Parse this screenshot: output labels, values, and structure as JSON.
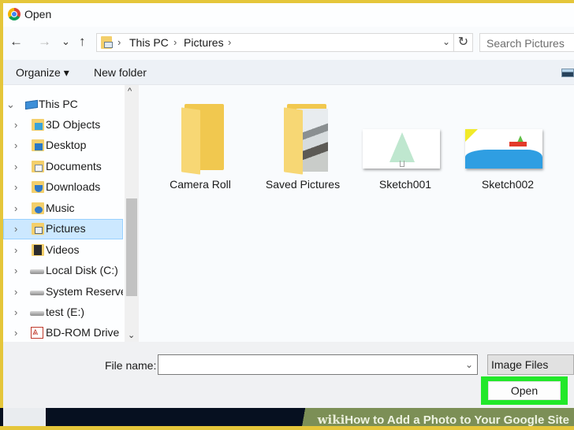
{
  "window": {
    "title": "Open",
    "app_icon": "chrome-icon"
  },
  "nav": {
    "back_icon": "arrow-left-icon",
    "forward_icon": "arrow-right-icon",
    "recent_icon": "chevron-down-icon",
    "up_icon": "arrow-up-icon",
    "glyphs": {
      "back": "←",
      "forward": "→",
      "recent": "⌄",
      "up": "↑",
      "sep": "›",
      "dropdown": "⌄",
      "refresh": "↻"
    },
    "breadcrumb": [
      "This PC",
      "Pictures"
    ],
    "search_placeholder": "Search Pictures"
  },
  "toolbar": {
    "organize_label": "Organize ▾",
    "new_folder_label": "New folder"
  },
  "sidebar": {
    "root": {
      "label": "This PC",
      "expanded": true,
      "icon": "computer-icon"
    },
    "items": [
      {
        "label": "3D Objects",
        "icon": "3d-objects-icon"
      },
      {
        "label": "Desktop",
        "icon": "desktop-icon"
      },
      {
        "label": "Documents",
        "icon": "documents-icon"
      },
      {
        "label": "Downloads",
        "icon": "downloads-icon"
      },
      {
        "label": "Music",
        "icon": "music-icon"
      },
      {
        "label": "Pictures",
        "icon": "pictures-icon",
        "selected": true
      },
      {
        "label": "Videos",
        "icon": "videos-icon"
      },
      {
        "label": "Local Disk (C:)",
        "icon": "drive-icon"
      },
      {
        "label": "System Reserved",
        "icon": "drive-icon"
      },
      {
        "label": "test (E:)",
        "icon": "drive-icon"
      },
      {
        "label": "BD-ROM Drive (",
        "icon": "bd-rom-icon"
      }
    ],
    "glyphs": {
      "collapsed": "›",
      "expanded": "⌄",
      "scroll_up": "^",
      "scroll_down": "⌄"
    }
  },
  "content": {
    "items": [
      {
        "label": "Camera Roll",
        "type": "folder"
      },
      {
        "label": "Saved Pictures",
        "type": "folder-with-photo"
      },
      {
        "label": "Sketch001",
        "type": "image"
      },
      {
        "label": "Sketch002",
        "type": "image"
      }
    ]
  },
  "footer": {
    "file_name_label": "File name:",
    "file_name_value": "",
    "file_type": "Image Files",
    "open_label": "Open",
    "highlight_color": "#22e82a"
  },
  "watermark": {
    "brand": "wiki",
    "text": "How to Add a Photo to Your Google Site"
  }
}
